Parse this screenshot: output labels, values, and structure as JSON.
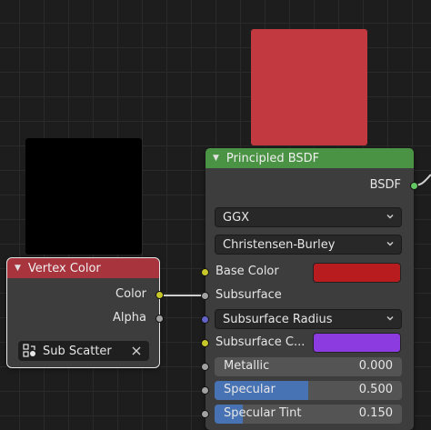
{
  "colors": {
    "principled_header": "#4a9344",
    "vertex_header": "#a8353e",
    "preview_red": "#c23a3f",
    "preview_black": "#000000",
    "base_color": "#b81c1f",
    "subsurface_color": "#8c3be0",
    "socket_yellow": "#c7c729",
    "socket_gray": "#a1a1a1",
    "socket_blue": "#6363c7",
    "socket_green": "#63c763",
    "link": "#cfcfcf",
    "slider_fill": "#4772b3"
  },
  "vertex_color_node": {
    "title": "Vertex Color",
    "outputs": [
      {
        "label": "Color",
        "socket": "yellow"
      },
      {
        "label": "Alpha",
        "socket": "gray"
      }
    ],
    "layer_name": "Sub Scatter"
  },
  "principled_node": {
    "title": "Principled BSDF",
    "output_label": "BSDF",
    "distribution": "GGX",
    "subsurface_method": "Christensen-Burley",
    "inputs": {
      "base_color": {
        "label": "Base Color"
      },
      "subsurface": {
        "label": "Subsurface"
      },
      "subsurface_radius": {
        "label": "Subsurface Radius"
      },
      "subsurface_color": {
        "label": "Subsurface C..."
      },
      "metallic": {
        "label": "Metallic",
        "value": "0.000",
        "fraction": 0.0
      },
      "specular": {
        "label": "Specular",
        "value": "0.500",
        "fraction": 0.5
      },
      "specular_tint": {
        "label": "Specular Tint",
        "value": "0.150",
        "fraction": 0.15
      }
    }
  }
}
